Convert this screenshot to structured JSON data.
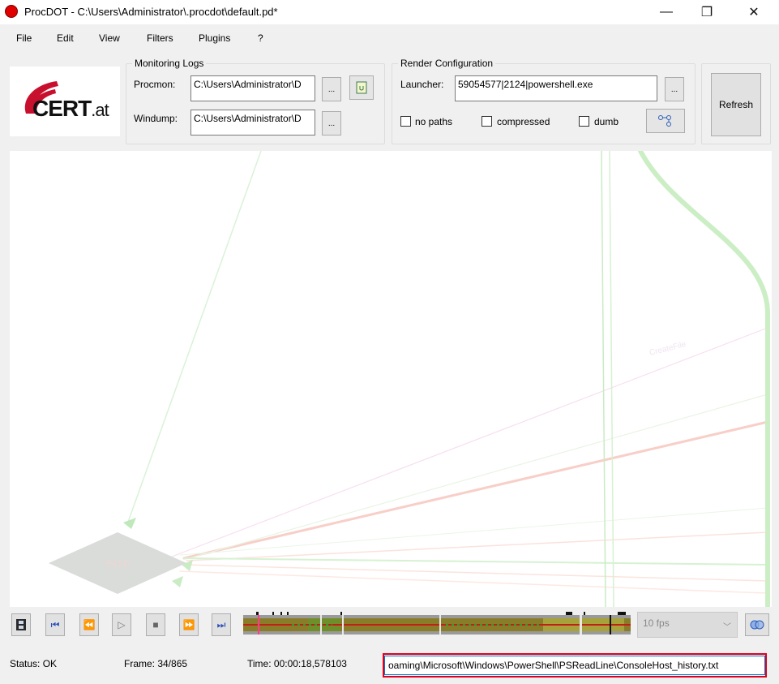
{
  "window": {
    "title": "ProcDOT - C:\\Users\\Administrator\\.procdot\\default.pd*",
    "minimize_glyph": "—",
    "maximize_glyph": "❐",
    "close_glyph": "✕"
  },
  "menu": [
    "File",
    "Edit",
    "View",
    "Filters",
    "Plugins",
    "?"
  ],
  "logo": {
    "text_main": "CERT",
    "text_suffix": ".at"
  },
  "monitoring_logs": {
    "title": "Monitoring Logs",
    "procmon_label": "Procmon:",
    "procmon_value": "C:\\Users\\Administrator\\D",
    "windump_label": "Windump:",
    "windump_value": "C:\\Users\\Administrator\\D",
    "browse_label": "..."
  },
  "render_config": {
    "title": "Render Configuration",
    "launcher_label": "Launcher:",
    "launcher_value": "59054577|2124|powershell.exe",
    "browse_label": "...",
    "no_paths_label": "no paths",
    "compressed_label": "compressed",
    "dumb_label": "dumb"
  },
  "refresh_label": "Refresh",
  "graph": {
    "node_label": "6420",
    "edge_label": "CreateFile"
  },
  "fps": {
    "value": "10 fps"
  },
  "status": {
    "status_text": "Status:  OK",
    "frame_text": "Frame:  34/865",
    "time_text": "Time:  00:00:18,578103",
    "path_value": "oaming\\Microsoft\\Windows\\PowerShell\\PSReadLine\\ConsoleHost_history.txt"
  },
  "icons": {
    "app": "procdot-red-circle-icon",
    "film": "film-icon",
    "first": "skip-first-icon",
    "rewind": "rewind-icon",
    "play": "play-icon",
    "stop": "stop-icon",
    "forward": "fast-forward-icon",
    "last": "skip-last-icon",
    "sync": "sync-rings-icon",
    "graph": "graph-layout-icon",
    "log": "log-file-icon"
  }
}
